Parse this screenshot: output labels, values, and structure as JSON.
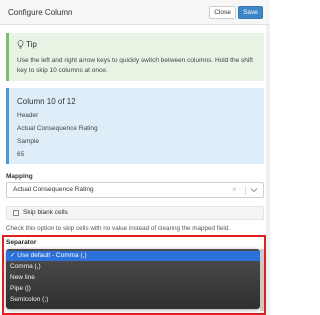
{
  "dialog": {
    "title": "Configure Column",
    "close_label": "Close",
    "save_label": "Save"
  },
  "tip": {
    "title": "Tip",
    "text": "Use the left and right arrow keys to quickly switch between columns. Hold the shift key to skip 10 columns at once."
  },
  "column_info": {
    "heading": "Column 10 of 12",
    "header_label": "Header",
    "header_value": "Actual Consequence Rating",
    "sample_label": "Sample",
    "sample_value": "65"
  },
  "mapping": {
    "label": "Mapping",
    "selected_value": "Actual Consequence Rating",
    "clear_glyph": "×"
  },
  "skip_blank": {
    "label": "Skip blank cells",
    "checked": false,
    "help_text": "Check this option to skip cells with no value instead of clearing the mapped field."
  },
  "separator": {
    "label": "Separator",
    "options": [
      {
        "label": "✓ Use default - Comma (,)",
        "selected": true
      },
      {
        "label": "Comma (,)",
        "selected": false
      },
      {
        "label": "New line",
        "selected": false
      },
      {
        "label": "Pipe (|)",
        "selected": false
      },
      {
        "label": "Semicolon (;)",
        "selected": false
      }
    ]
  },
  "colors": {
    "save_button": "#3c86c8",
    "tip_bg": "#e7f4e3",
    "info_bg": "#dfedf8",
    "highlight_border": "#e02020",
    "selected_option": "#2b71d8"
  }
}
